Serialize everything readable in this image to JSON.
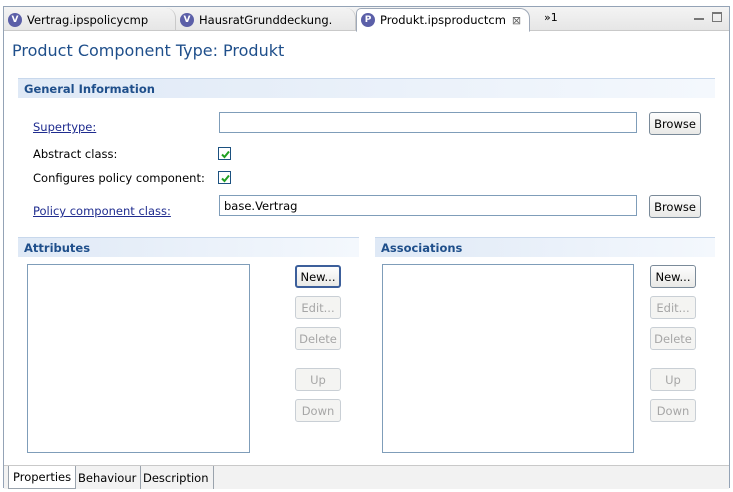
{
  "tabs": [
    {
      "label": "Vertrag.ipspolicycmp",
      "icon": "V"
    },
    {
      "label": "HausratGrunddeckung.",
      "icon": "V"
    },
    {
      "label": "Produkt.ipsproductcm",
      "icon": "P",
      "close": "⊠"
    }
  ],
  "tab_overflow": "»1",
  "page_title": "Product Component Type: Produkt",
  "general": {
    "title": "General Information",
    "supertype_label": "Supertype:",
    "supertype_value": "",
    "browse_label": "Browse",
    "abstract_label": "Abstract class:",
    "abstract_checked": true,
    "configures_label": "Configures policy component:",
    "configures_checked": true,
    "policy_class_label": "Policy component class:",
    "policy_class_value": "base.Vertrag"
  },
  "attributes": {
    "title": "Attributes",
    "buttons": {
      "new": "New...",
      "edit": "Edit...",
      "delete": "Delete",
      "up": "Up",
      "down": "Down"
    }
  },
  "associations": {
    "title": "Associations",
    "buttons": {
      "new": "New...",
      "edit": "Edit...",
      "delete": "Delete",
      "up": "Up",
      "down": "Down"
    }
  },
  "bottom_tabs": [
    "Properties",
    "Behaviour",
    "Description"
  ]
}
